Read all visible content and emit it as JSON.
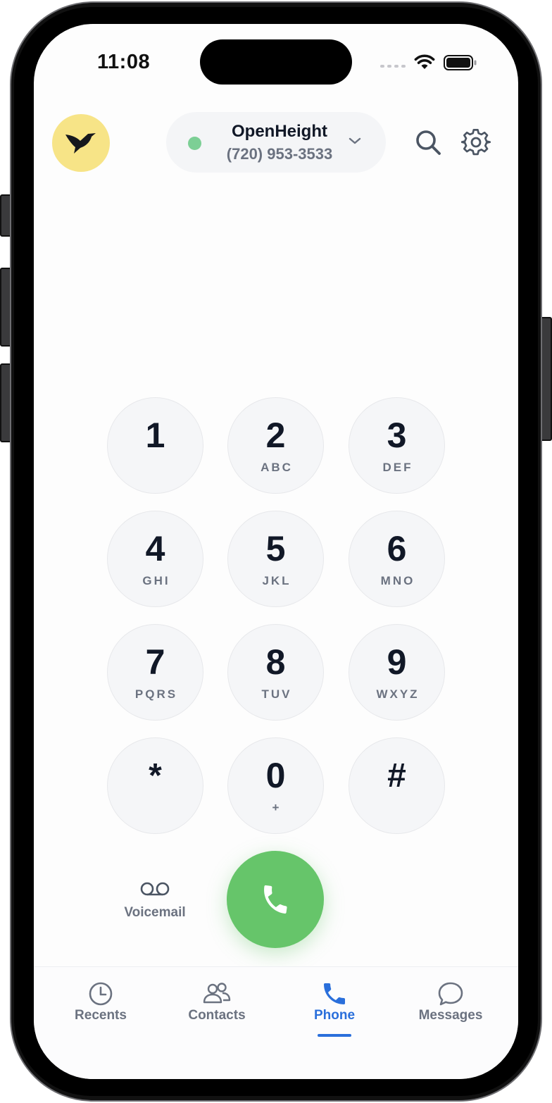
{
  "status_bar": {
    "time": "11:08"
  },
  "header": {
    "account_name": "OpenHeight",
    "account_number": "(720) 953-3533",
    "status_color": "#7ccf95"
  },
  "keypad": [
    {
      "digit": "1",
      "letters": ""
    },
    {
      "digit": "2",
      "letters": "ABC"
    },
    {
      "digit": "3",
      "letters": "DEF"
    },
    {
      "digit": "4",
      "letters": "GHI"
    },
    {
      "digit": "5",
      "letters": "JKL"
    },
    {
      "digit": "6",
      "letters": "MNO"
    },
    {
      "digit": "7",
      "letters": "PQRS"
    },
    {
      "digit": "8",
      "letters": "TUV"
    },
    {
      "digit": "9",
      "letters": "WXYZ"
    },
    {
      "digit": "*",
      "letters": ""
    },
    {
      "digit": "0",
      "letters": "+"
    },
    {
      "digit": "#",
      "letters": ""
    }
  ],
  "actions": {
    "voicemail_label": "Voicemail",
    "call_color": "#66c56a"
  },
  "tabs": [
    {
      "label": "Recents",
      "icon": "clock-icon"
    },
    {
      "label": "Contacts",
      "icon": "contacts-icon"
    },
    {
      "label": "Phone",
      "icon": "phone-icon",
      "active": true
    },
    {
      "label": "Messages",
      "icon": "message-bubble-icon"
    }
  ],
  "colors": {
    "accent": "#2a6fdb",
    "logo_bg": "#f7e487"
  }
}
